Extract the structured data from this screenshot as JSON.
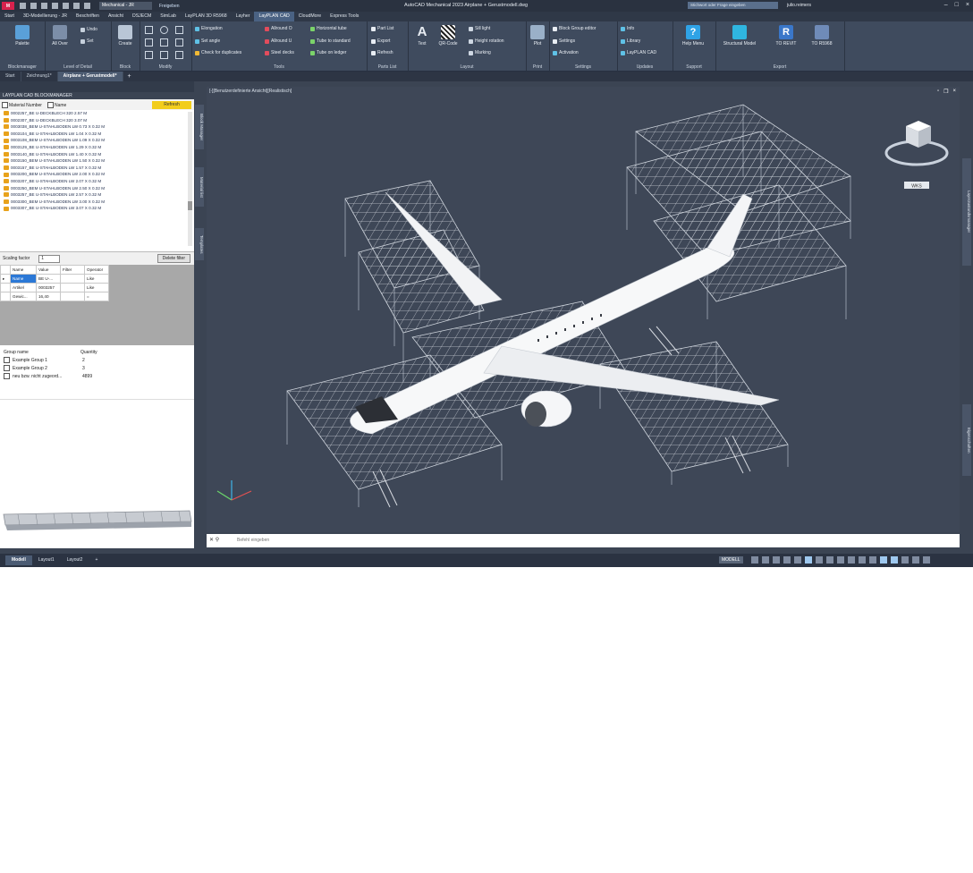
{
  "titlebar": {
    "workspace": "Mechanical - JR",
    "share": "Freigeben",
    "title": "AutoCAD Mechanical 2023    Airplane + Gerustmodell.dwg",
    "search_placeholder": "Stichwort oder Frage eingeben",
    "user": "julio.reimers"
  },
  "menu_tabs": [
    "Start",
    "3D-Modellierung - JR",
    "Beschriften",
    "Ansicht",
    "DSJECM",
    "SimLab",
    "LayPLAN 3D R5968",
    "Layher",
    "LayPLAN CAD",
    "CloudMore",
    "Express Tools"
  ],
  "ribbon": {
    "blockmanager": {
      "button": "Palette",
      "title": "Blockmanager"
    },
    "lod": {
      "button": "All Over",
      "b2": "Undo",
      "b3": "Set",
      "title": "Level of Detail"
    },
    "block": {
      "button": "Create",
      "title": "Block"
    },
    "modify": {
      "title": "Modify"
    },
    "tools": {
      "items": [
        "Elongation",
        "Set angle",
        "Check for duplicates",
        "Allround O",
        "Allround U",
        "Steel decks",
        "Horizontal tube",
        "Tube to standard",
        "Tube on ledger"
      ],
      "title": "Tools"
    },
    "parts": {
      "items": [
        "Part List",
        "Export",
        "Refresh"
      ],
      "title": "Parts List"
    },
    "layout": {
      "text": "Text",
      "qr": "QR-Code",
      "items": [
        "Sill light",
        "Height rotation",
        "Marking"
      ],
      "title": "Layout"
    },
    "print": {
      "button": "Plot",
      "title": "Print"
    },
    "settings": {
      "items": [
        "Block Group editor",
        "Settings",
        "Activation"
      ],
      "title": "Settings"
    },
    "updates": {
      "items": [
        "Info",
        "Library",
        "LayPLAN CAD"
      ],
      "title": "Updates"
    },
    "support": {
      "button": "Help Menu",
      "title": "Support"
    },
    "export": {
      "items": [
        "Structural Model",
        "TO REVIT",
        "TO R5968"
      ],
      "title": "Export"
    }
  },
  "doc_tabs": [
    "Start",
    "Zeichnung1*",
    "Airplane + Gerustmodell*"
  ],
  "left_panel": {
    "header": "LAYPLAN CAD BLOCKMANAGER",
    "filter_material": "Material Number",
    "filter_name": "Name",
    "refresh": "Refresh",
    "blocks": [
      "0002257_BE U-DECKBLECH 320 2.57 M",
      "0002307_BE U-DECKBLECH 320 3.07 M",
      "0003038_BEM U-STAHLBODEN LW 0.73 X 0.32 M",
      "0003104_BE U-STAHLBODEN LW 1.04 X 0.32 M",
      "0003108_BEM U-STAHLBODEN LW 1.09 X 0.32 M",
      "0003129_BE U-STAHLBODEN LW 1.29 X 0.32 M",
      "0003140_BE U-STAHLBODEN LW 1.40 X 0.32 M",
      "0003150_BEM U-STAHLBODEN LW 1.50 X 0.32 M",
      "0003157_BE U-STAHLBODEN LW 1.57 X 0.32 M",
      "0003200_BEM U-STAHLBODEN LW 2.00 X 0.32 M",
      "0003207_BE U-STAHLBODEN LW 2.07 X 0.32 M",
      "0003250_BEM U-STAHLBODEN LW 2.50 X 0.32 M",
      "0003257_BE U-STAHLBODEN LW 2.57 X 0.32 M",
      "0003300_BEM U-STAHLBODEN LW 3.00 X 0.32 M",
      "0003307_BE U-STAHLBODEN LW 3.07 X 0.32 M"
    ],
    "scaling_label": "Scaling factor",
    "scaling_value": "1",
    "delete_filter": "Delete filter",
    "grid_headers": [
      "Name",
      "Value",
      "Filter",
      "Operator"
    ],
    "grid_rows": [
      [
        "Name",
        "BE U-...",
        "",
        "Like"
      ],
      [
        "Artikel",
        "0003257",
        "",
        "Like"
      ],
      [
        "Gewic...",
        "16,40",
        "",
        "="
      ]
    ],
    "group_header": "Group name",
    "quantity_header": "Quantity",
    "groups": [
      {
        "name": "Example Group 1",
        "qty": "2"
      },
      {
        "name": "Example Group 2",
        "qty": "3"
      },
      {
        "name": "neu bzw. nicht zugeord...",
        "qty": "4899"
      }
    ]
  },
  "side_tabs": [
    "Block Manager",
    "Material list",
    "Templates"
  ],
  "right_tabs": [
    "Layerzustandsmanager",
    "Eigenschaften"
  ],
  "viewport": {
    "label": "[-][Benutzerdefinierte Ansicht][Realistisch]",
    "viewcube_label": "WKS"
  },
  "command": {
    "placeholder": "Befehl eingeben"
  },
  "layout_tabs": [
    "Modell",
    "Layout1",
    "Layout2"
  ],
  "status": {
    "model": "MODELL"
  },
  "colors": {
    "accent": "#4a6283",
    "refresh": "#f2cd1c",
    "viewport": "#3e4757"
  }
}
